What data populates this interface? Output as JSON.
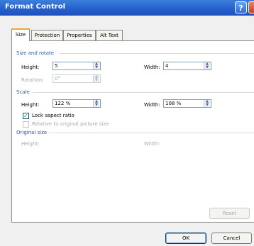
{
  "window": {
    "title": "Format Control"
  },
  "tabs": [
    {
      "label": "Size",
      "active": true
    },
    {
      "label": "Protection",
      "active": false
    },
    {
      "label": "Properties",
      "active": false
    },
    {
      "label": "Alt Text",
      "active": false
    }
  ],
  "size_rotate": {
    "heading": "Size and rotate",
    "height_label": "Height:",
    "height_value": "5",
    "width_label": "Width:",
    "width_value": "4",
    "rotation_label": "Rotation:",
    "rotation_value": "0°"
  },
  "scale": {
    "heading": "Scale",
    "height_label": "Height:",
    "height_value": "122 %",
    "width_label": "Width:",
    "width_value": "108 %",
    "lock_aspect_label": "Lock aspect ratio",
    "lock_aspect_checked": true,
    "relative_label": "Relative to original picture size",
    "relative_checked": false
  },
  "original_size": {
    "heading": "Original size",
    "height_label": "Height:",
    "width_label": "Width:"
  },
  "buttons": {
    "reset": "Reset",
    "ok": "OK",
    "cancel": "Cancel"
  },
  "colors": {
    "title_bar": "#245ecb",
    "group_heading": "#2b56b3",
    "active_tab_accent": "#f2a62d"
  }
}
